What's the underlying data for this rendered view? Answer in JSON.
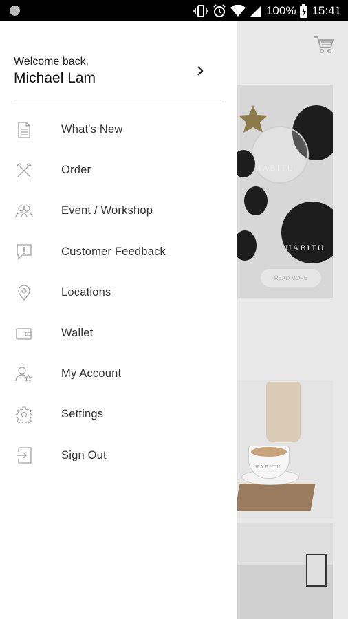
{
  "status_bar": {
    "battery": "100%",
    "time": "15:41",
    "icons": [
      "notification-dot-icon",
      "vibrate-icon",
      "alarm-icon",
      "wifi-icon",
      "signal-icon",
      "battery-icon"
    ]
  },
  "drawer": {
    "welcome_text": "Welcome back,",
    "user_name": "Michael Lam",
    "chevron_icon": "chevron-right-icon",
    "menu": [
      {
        "label": "What's New",
        "icon": "document-icon"
      },
      {
        "label": "Order",
        "icon": "utensils-icon"
      },
      {
        "label": "Event / Workshop",
        "icon": "people-icon"
      },
      {
        "label": "Customer Feedback",
        "icon": "feedback-icon"
      },
      {
        "label": "Locations",
        "icon": "location-pin-icon"
      },
      {
        "label": "Wallet",
        "icon": "wallet-icon"
      },
      {
        "label": "My Account",
        "icon": "user-star-icon"
      },
      {
        "label": "Settings",
        "icon": "gear-icon"
      },
      {
        "label": "Sign Out",
        "icon": "sign-out-icon"
      }
    ]
  },
  "background": {
    "cart_icon": "shopping-cart-icon",
    "card1_brand": "HABITU",
    "card1_button": "READ MORE",
    "card2_brand": "HABITU"
  },
  "colors": {
    "status_bar": "#000000",
    "drawer_bg": "#ffffff",
    "scrim": "#e9e9e9",
    "text": "#333333",
    "icon": "#9e9e9e"
  }
}
